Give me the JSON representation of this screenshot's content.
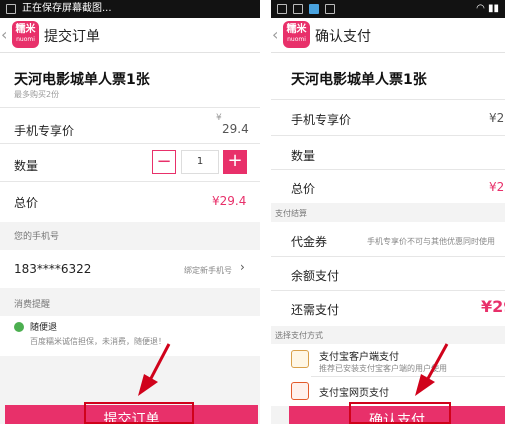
{
  "left": {
    "status_text": "正在保存屏幕截图...",
    "logo": {
      "line1": "糯米",
      "line2": "nuomi"
    },
    "title": "提交订单",
    "product": {
      "name": "天河电影城单人票1张",
      "limit": "最多购买2份"
    },
    "price_label": "手机专享价",
    "price_currency": "¥",
    "price_value": "29.4",
    "qty_label": "数量",
    "qty_minus": "−",
    "qty_value": "1",
    "qty_plus": "+",
    "total_label": "总价",
    "total_value": "¥29.4",
    "phone_section": "您的手机号",
    "phone": "183****6322",
    "bind_text": "绑定新手机号",
    "reminder_section": "消费提醒",
    "guarantee_title": "随便退",
    "guarantee_text": "百度糯米诚信担保，未消费，随便退！",
    "submit_label": "提交订单"
  },
  "right": {
    "logo": {
      "line1": "糯米",
      "line2": "nuomi"
    },
    "title": "确认支付",
    "product_name": "天河电影城单人票1张",
    "price_label": "手机专享价",
    "price_value_partial": "¥2",
    "qty_label": "数量",
    "total_label": "总价",
    "total_value_partial": "¥2",
    "settle_section": "支付结算",
    "voucher_label": "代金券",
    "voucher_note": "手机专享价不可与其他优惠同时使用",
    "balance_label": "余额支付",
    "need_label": "还需支付",
    "need_value_partial": "¥29",
    "method_section": "选择支付方式",
    "alipay_client": "支付宝客户端支付",
    "alipay_client_desc": "推荐已安装支付宝客户端的用户使用",
    "alipay_web": "支付宝网页支付",
    "confirm_label": "确认支付"
  },
  "colors": {
    "accent": "#e8306a",
    "annotation": "#d0021b"
  }
}
